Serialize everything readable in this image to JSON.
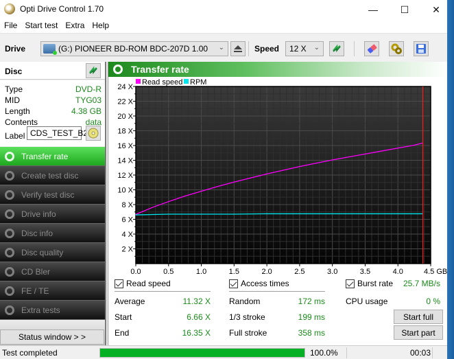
{
  "window": {
    "title": "Opti Drive Control 1.70",
    "controls": {
      "minimize": "—",
      "maximize": "☐",
      "close": "✕"
    }
  },
  "menu": [
    "File",
    "Start test",
    "Extra",
    "Help"
  ],
  "toolbar": {
    "drive_label": "Drive",
    "drive_value": "(G:)  PIONEER BD-ROM  BDC-207D 1.00",
    "speed_label": "Speed",
    "speed_value": "12 X",
    "icons": [
      "eject-icon",
      "refresh-icon",
      "erase-icon",
      "settings-icon",
      "save-icon"
    ]
  },
  "disc": {
    "title": "Disc",
    "rows": [
      {
        "key": "Type",
        "value": "DVD-R"
      },
      {
        "key": "MID",
        "value": "TYG03"
      },
      {
        "key": "Length",
        "value": "4.38 GB"
      },
      {
        "key": "Contents",
        "value": "data"
      }
    ],
    "label_key": "Label",
    "label_value": "CDS_TEST_B2"
  },
  "nav": [
    {
      "label": "Transfer rate",
      "active": true
    },
    {
      "label": "Create test disc",
      "active": false
    },
    {
      "label": "Verify test disc",
      "active": false
    },
    {
      "label": "Drive info",
      "active": false
    },
    {
      "label": "Disc info",
      "active": false
    },
    {
      "label": "Disc quality",
      "active": false
    },
    {
      "label": "CD Bler",
      "active": false
    },
    {
      "label": "FE / TE",
      "active": false
    },
    {
      "label": "Extra tests",
      "active": false
    }
  ],
  "status_window_button": "Status window > >",
  "main": {
    "title": "Transfer rate"
  },
  "chart_data": {
    "type": "line",
    "title": "Transfer rate",
    "xlabel": "GB",
    "ylabel": "X",
    "xlim": [
      0,
      4.5
    ],
    "ylim": [
      0,
      24
    ],
    "x_ticks": [
      "0.0",
      "0.5",
      "1.0",
      "1.5",
      "2.0",
      "2.5",
      "3.0",
      "3.5",
      "4.0",
      "4.5 GB"
    ],
    "y_ticks": [
      "2 X",
      "4 X",
      "6 X",
      "8 X",
      "10 X",
      "12 X",
      "14 X",
      "16 X",
      "18 X",
      "20 X",
      "22 X",
      "24 X"
    ],
    "grid": true,
    "legend": "top-left",
    "end_marker_x": 4.38,
    "series": [
      {
        "name": "Read speed",
        "color": "#ff00ff",
        "x": [
          0.0,
          0.25,
          0.5,
          0.75,
          1.0,
          1.25,
          1.5,
          1.75,
          2.0,
          2.25,
          2.5,
          2.75,
          3.0,
          3.25,
          3.5,
          3.75,
          4.0,
          4.25,
          4.38
        ],
        "y": [
          6.66,
          7.6,
          8.4,
          9.15,
          9.8,
          10.45,
          11.05,
          11.6,
          12.15,
          12.65,
          13.15,
          13.6,
          14.05,
          14.45,
          14.85,
          15.25,
          15.65,
          16.05,
          16.35
        ]
      },
      {
        "name": "RPM",
        "color": "#00e5ee",
        "x": [
          0.0,
          0.5,
          1.0,
          1.5,
          2.0,
          2.5,
          3.0,
          3.5,
          4.0,
          4.38
        ],
        "y": [
          6.6,
          6.7,
          6.7,
          6.7,
          6.75,
          6.75,
          6.75,
          6.75,
          6.75,
          6.75
        ]
      }
    ]
  },
  "stats": {
    "read_speed": {
      "label": "Read speed",
      "rows": [
        {
          "key": "Average",
          "value": "11.32 X"
        },
        {
          "key": "Start",
          "value": "6.66 X"
        },
        {
          "key": "End",
          "value": "16.35 X"
        }
      ]
    },
    "access_times": {
      "label": "Access times",
      "rows": [
        {
          "key": "Random",
          "value": "172 ms"
        },
        {
          "key": "1/3 stroke",
          "value": "199 ms"
        },
        {
          "key": "Full stroke",
          "value": "358 ms"
        }
      ]
    },
    "burst_rate": {
      "label": "Burst rate",
      "value": "25.7 MB/s"
    },
    "cpu_usage": {
      "label": "CPU usage",
      "value": "0 %"
    },
    "start_full": "Start full",
    "start_part": "Start part"
  },
  "statusbar": {
    "text": "Test completed",
    "progress": 1.0,
    "percent": "100.0%",
    "time": "00:03"
  }
}
